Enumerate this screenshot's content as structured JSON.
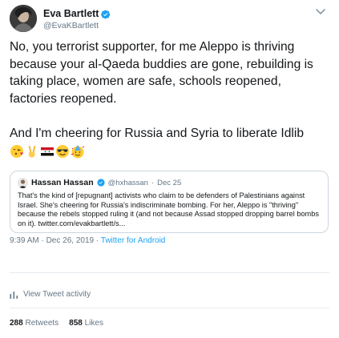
{
  "author": {
    "display_name": "Eva Bartlett",
    "handle": "@EvaKBartlett"
  },
  "tweet": {
    "text": "No, you terrorist supporter, for me Aleppo is thriving because your al-Qaeda buddies are gone, rebuilding is taking place, women are safe, schools reopened, factories reopened.\n\nAnd I'm cheering for Russia and Syria to liberate Idlib",
    "emojis": [
      "kissing-face-with-heart",
      "victory-hand",
      "syria-flag",
      "smiling-face-with-sunglasses",
      "party-face"
    ]
  },
  "quoted": {
    "display_name": "Hassan Hassan",
    "handle": "@hxhassan",
    "separator": "·",
    "date": "Dec 25",
    "text": "That's the kind of [repugnant] activists who claim to be defenders of Palestinians against Israel. She's cheering for Russia's indiscriminate bombing. For her, Aleppo is \"thriving\" because the rebels stopped ruling it (and not because Assad stopped dropping barrel bombs on it). twitter.com/evakbartlett/s..."
  },
  "meta": {
    "time": "9:39 AM · Dec 26, 2019 · ",
    "app": "Twitter for Android"
  },
  "activity": {
    "label": "View Tweet activity"
  },
  "stats": {
    "retweets_count": "288",
    "retweets_label": "Retweets",
    "likes_count": "858",
    "likes_label": "Likes"
  },
  "colors": {
    "accent": "#1da1f2",
    "secondary_text": "#657786",
    "border": "#ccd6dd"
  }
}
